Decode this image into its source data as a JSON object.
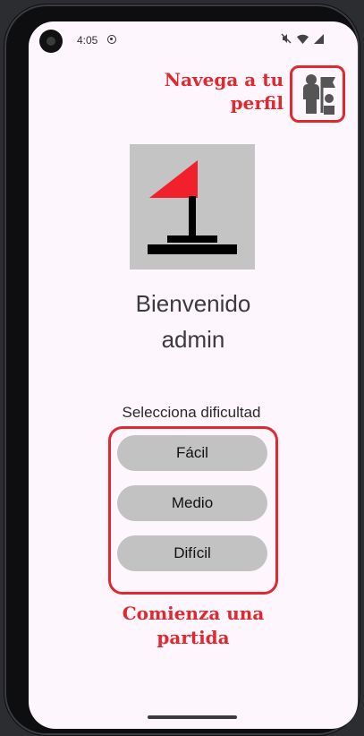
{
  "status_bar": {
    "time": "4:05",
    "icons": [
      "camera-icon",
      "sync-icon",
      "mute-icon",
      "wifi-icon",
      "signal-icon"
    ]
  },
  "annotations": {
    "profile_line1": "Navega a tu",
    "profile_line2": "perfil",
    "start_line1": "Comienza una",
    "start_line2": "partida",
    "color": "#e0282e"
  },
  "header": {
    "profile_icon": "profile-flag-icon"
  },
  "logo": {
    "icon": "golf-flag-logo",
    "background": "#c4c4c4",
    "flag_color": "#f0202c"
  },
  "welcome": {
    "title": "Bienvenido",
    "user": "admin"
  },
  "difficulty": {
    "label": "Selecciona dificultad",
    "options": [
      "Fácil",
      "Medio",
      "Difícil"
    ]
  }
}
